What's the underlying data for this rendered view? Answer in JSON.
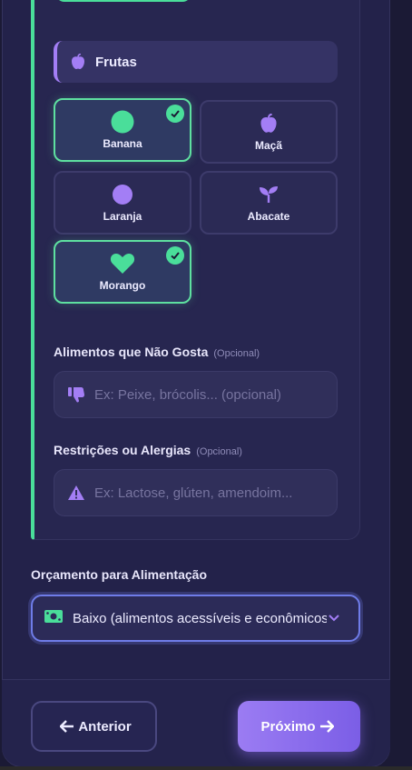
{
  "fruits_group": {
    "icon": "apple-icon",
    "title": "Frutas",
    "items": [
      {
        "label": "Banana",
        "icon": "circle-icon",
        "selected": true
      },
      {
        "label": "Maçã",
        "icon": "apple-icon",
        "selected": false
      },
      {
        "label": "Laranja",
        "icon": "circle-icon",
        "selected": false
      },
      {
        "label": "Abacate",
        "icon": "sprout-icon",
        "selected": false
      },
      {
        "label": "Morango",
        "icon": "heart-icon",
        "selected": true
      }
    ]
  },
  "dislikes": {
    "label": "Alimentos que Não Gosta",
    "optional": "(Opcional)",
    "placeholder": "Ex: Peixe, brócolis... (opcional)",
    "icon": "thumbs-down-icon"
  },
  "restrictions": {
    "label": "Restrições ou Alergias",
    "optional": "(Opcional)",
    "placeholder": "Ex: Lactose, glúten, amendoim...",
    "icon": "warning-icon"
  },
  "budget": {
    "label": "Orçamento para Alimentação",
    "value": "Baixo (alimentos acessíveis e econômicos)",
    "icon": "money-icon"
  },
  "nav": {
    "prev_label": "Anterior",
    "next_label": "Próximo"
  },
  "colors": {
    "accent_green": "#4ade9a",
    "accent_purple": "#a37ef5",
    "background": "#1b1a35"
  }
}
